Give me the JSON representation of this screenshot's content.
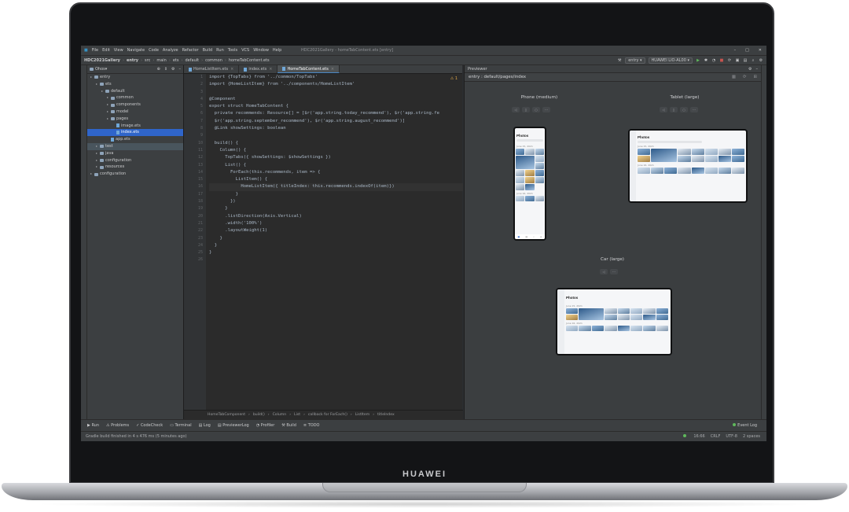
{
  "laptop": {
    "brand": "HUAWEI"
  },
  "menubar": {
    "items": [
      "File",
      "Edit",
      "View",
      "Navigate",
      "Code",
      "Analyze",
      "Refactor",
      "Build",
      "Run",
      "Tools",
      "VCS",
      "Window",
      "Help"
    ],
    "window_title": "HDC2021Gallery - homeTabContent.ets [entry]"
  },
  "navbar": {
    "crumbs": [
      "HDC2021Gallery",
      "entry",
      "src",
      "main",
      "ets",
      "default",
      "common",
      "homeTabContent.ets"
    ],
    "run_config": "entry",
    "device": "HUAWEI LIO-AL00"
  },
  "project": {
    "title": "Ohos",
    "tree": [
      {
        "label": "entry",
        "depth": 0,
        "type": "folder"
      },
      {
        "label": "ets",
        "depth": 1,
        "type": "folder"
      },
      {
        "label": "default",
        "depth": 2,
        "type": "folder"
      },
      {
        "label": "common",
        "depth": 3,
        "type": "folder"
      },
      {
        "label": "components",
        "depth": 3,
        "type": "folder"
      },
      {
        "label": "model",
        "depth": 3,
        "type": "folder"
      },
      {
        "label": "pages",
        "depth": 3,
        "type": "folder"
      },
      {
        "label": "image.ets",
        "depth": 4,
        "type": "file"
      },
      {
        "label": "index.ets",
        "depth": 4,
        "type": "file",
        "selected": true
      },
      {
        "label": "app.ets",
        "depth": 3,
        "type": "file"
      },
      {
        "label": "test",
        "depth": 1,
        "type": "folder",
        "highlight": true
      },
      {
        "label": "java",
        "depth": 1,
        "type": "folder"
      },
      {
        "label": "configuration",
        "depth": 1,
        "type": "folder"
      },
      {
        "label": "resources",
        "depth": 1,
        "type": "folder"
      },
      {
        "label": "configuration",
        "depth": 0,
        "type": "folder"
      }
    ]
  },
  "editor": {
    "tabs": [
      {
        "label": "HomeListItem.ets",
        "active": false
      },
      {
        "label": "index.ets",
        "active": false
      },
      {
        "label": "HomeTabContent.ets",
        "active": true
      }
    ],
    "warnings": "1",
    "code": [
      "import {TopTabs} from '../common/TopTabs'",
      "import {HomeListItem} from '../components/HomeListItem'",
      "",
      "@Component",
      "export struct HomeTabContent {",
      "  private recommends: Resource[] = [$r('app.string.today_recommend'), $r('app.string.fe",
      "  $r('app.string.september_recommend'), $r('app.string.august_recommend')]",
      "  @Link showSettings: boolean",
      "",
      "  build() {",
      "    Column() {",
      "      TopTabs({ showSettings: $showSettings })",
      "      List() {",
      "        ForEach(this.recommends, item => {",
      "          ListItem() {",
      "            HomeListItem({ titleIndex: this.recommends.indexOf(item)})",
      "          }",
      "        })",
      "      }",
      "      .listDirection(Axis.Vertical)",
      "      .width('100%')",
      "      .layoutWeight(1)",
      "    }",
      "  }",
      "}",
      ""
    ],
    "breadcrumbs": [
      "HomeTabComponent",
      "build()",
      "Column",
      "List",
      "callback for ForEach()",
      "ListItem",
      "titleIndex"
    ]
  },
  "previewer": {
    "title": "Previewer",
    "path": "entry : default/pages/index",
    "devices": [
      {
        "label": "Phone (medium)"
      },
      {
        "label": "Tablet (large)"
      },
      {
        "label": "Car (large)"
      }
    ],
    "app": {
      "title": "Photos",
      "section1": "June 15, 2021",
      "section2": "June 16, 2021"
    }
  },
  "toolwindows": {
    "items": [
      "Run",
      "Problems",
      "CodeCheck",
      "Terminal",
      "Log",
      "PreviewerLog",
      "Profiler",
      "Build",
      "TODO"
    ],
    "right": "Event Log"
  },
  "status": {
    "message": "Gradle build finished in 4 s 476 ms (5 minutes ago)",
    "position": "16:66",
    "line_sep": "CRLF",
    "encoding": "UTF-8",
    "indent": "2 spaces"
  },
  "colors": {
    "accent": "#2f65ca",
    "ide_bg": "#2b2b2b",
    "panel_bg": "#3c3f41"
  }
}
